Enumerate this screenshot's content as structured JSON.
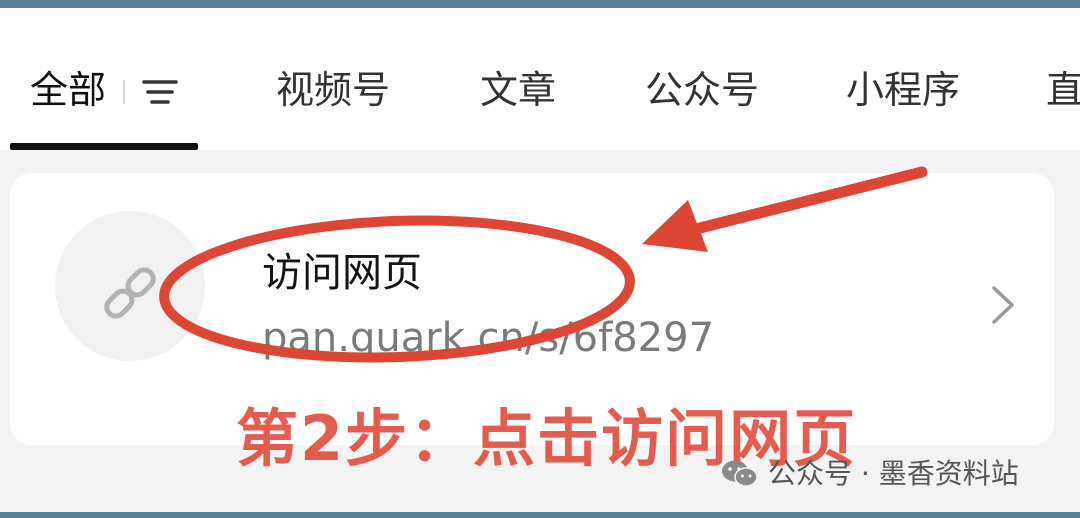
{
  "tabs": {
    "all": "全部",
    "items": [
      "视频号",
      "文章",
      "公众号",
      "小程序",
      "直"
    ]
  },
  "result": {
    "title": "访问网页",
    "url": "pan.quark.cn/s/6f8297"
  },
  "annotation": {
    "step_text": "第2步：点击访问网页",
    "color": "#e24b3c"
  },
  "watermark": {
    "label": "公众号 · 墨香资料站"
  },
  "icons": [
    "filter-icon",
    "link-icon",
    "chevron-right-icon",
    "wechat-icon"
  ]
}
